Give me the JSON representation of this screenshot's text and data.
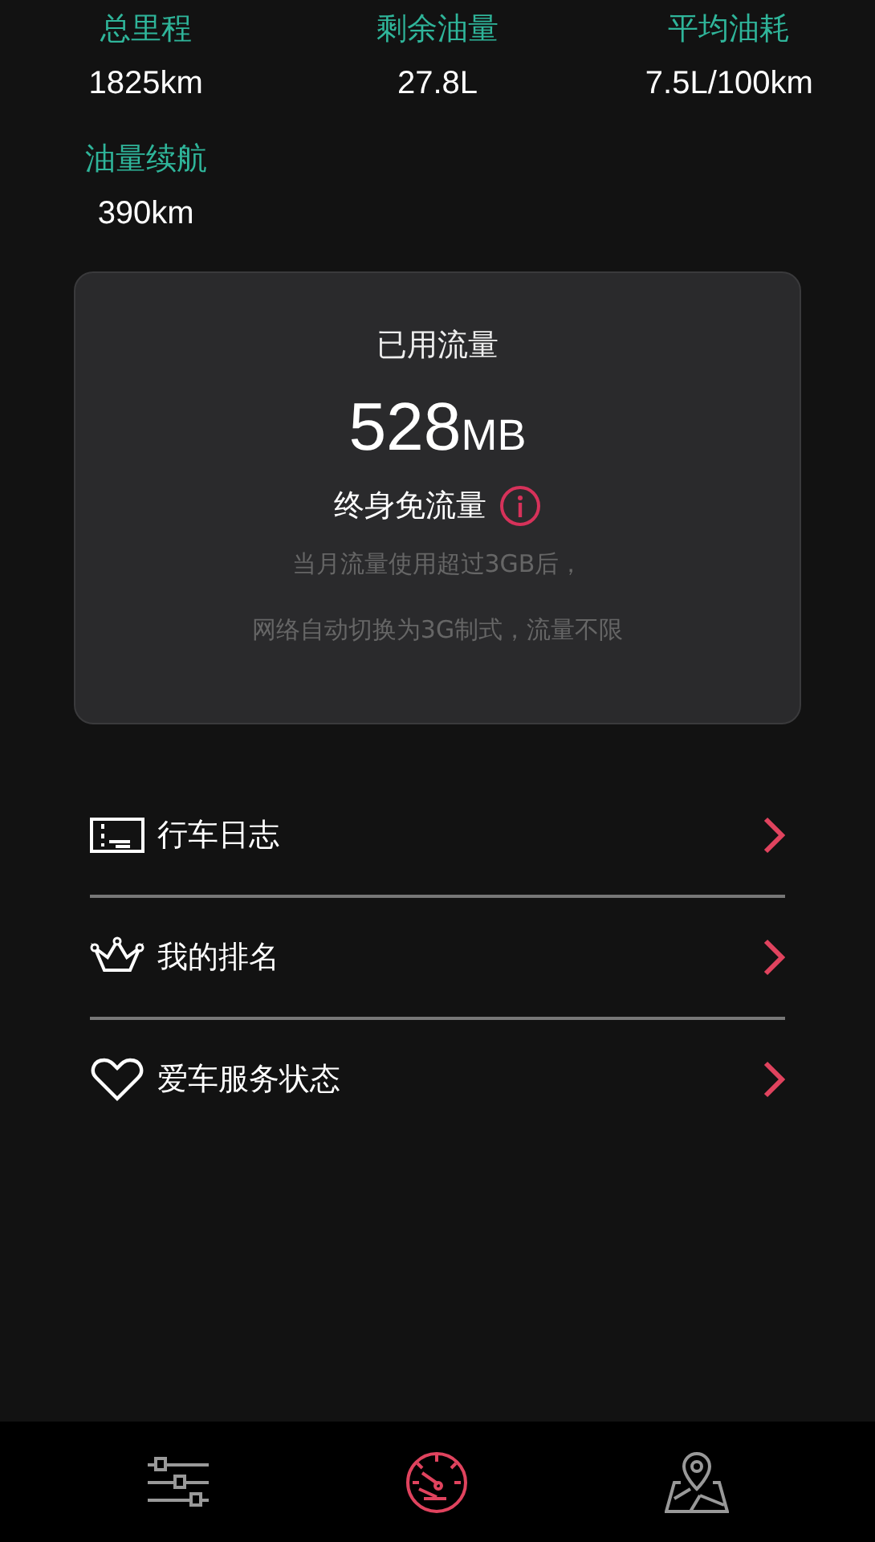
{
  "stats": [
    {
      "label": "总里程",
      "value": "1825km"
    },
    {
      "label": "剩余油量",
      "value": "27.8L"
    },
    {
      "label": "平均油耗",
      "value": "7.5L/100km"
    },
    {
      "label": "油量续航",
      "value": "390km"
    }
  ],
  "data_card": {
    "title": "已用流量",
    "amount": "528",
    "unit": "MB",
    "plan": "终身免流量",
    "notes": [
      "当月流量使用超过3GB后，",
      "网络自动切换为3G制式，流量不限"
    ]
  },
  "menu": [
    {
      "kind": "log",
      "label": "行车日志"
    },
    {
      "kind": "crown",
      "label": "我的排名"
    },
    {
      "kind": "heart",
      "label": "爱车服务状态"
    }
  ],
  "nav": [
    {
      "kind": "sliders",
      "selected": false
    },
    {
      "kind": "gauge",
      "selected": true
    },
    {
      "kind": "map",
      "selected": false
    }
  ]
}
